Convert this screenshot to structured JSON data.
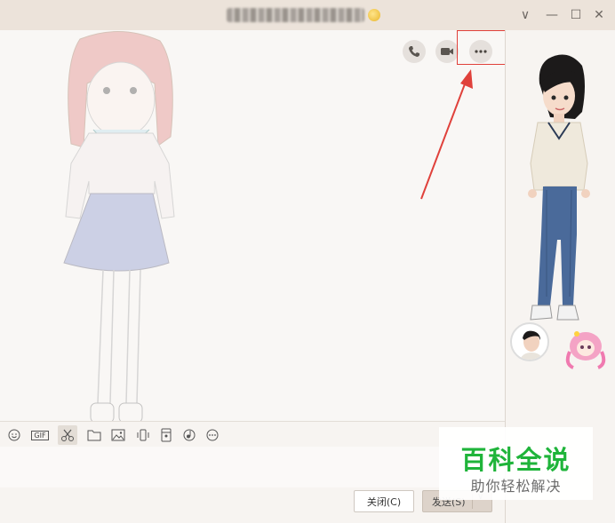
{
  "titlebar": {
    "title": "",
    "controls": {
      "collapse_glyph": "∨",
      "minimize_glyph": "—",
      "maximize_glyph": "☐",
      "close_glyph": "✕"
    }
  },
  "chat_header_icons": [
    "phone-icon",
    "video-call-icon",
    "more-icon"
  ],
  "toolbar": {
    "gif_label": "GIF",
    "icons": [
      "emoji-icon",
      "gif-icon",
      "screenshot-scissors-icon",
      "folder-icon",
      "image-icon",
      "shake-icon",
      "red-packet-icon",
      "music-icon",
      "more-tools-icon"
    ]
  },
  "buttons": {
    "close_label": "关闭(C)",
    "send_label": "发送(S)"
  },
  "watermark": {
    "title": "百科全说",
    "subtitle": "助你轻松解决"
  },
  "colors": {
    "highlight_border": "#e0413b",
    "annotation_arrow": "#e0413b",
    "watermark_green": "#1fb43a"
  }
}
